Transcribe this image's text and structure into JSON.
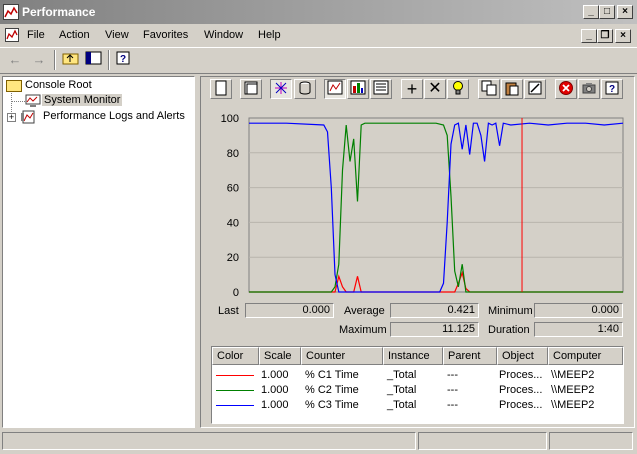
{
  "window": {
    "title": "Performance"
  },
  "menu": {
    "items": [
      "File",
      "Action",
      "View",
      "Favorites",
      "Window",
      "Help"
    ]
  },
  "tree": {
    "root": "Console Root",
    "children": [
      "System Monitor",
      "Performance Logs and Alerts"
    ]
  },
  "stats": {
    "last_label": "Last",
    "last": "0.000",
    "average_label": "Average",
    "average": "0.421",
    "minimum_label": "Minimum",
    "minimum": "0.000",
    "maximum_label": "Maximum",
    "maximum": "11.125",
    "duration_label": "Duration",
    "duration": "1:40"
  },
  "legend": {
    "headers": [
      "Color",
      "Scale",
      "Counter",
      "Instance",
      "Parent",
      "Object",
      "Computer"
    ],
    "rows": [
      {
        "color": "#ff0000",
        "scale": "1.000",
        "counter": "% C1 Time",
        "instance": "_Total",
        "parent": "---",
        "object": "Proces...",
        "computer": "\\\\MEEP2"
      },
      {
        "color": "#008000",
        "scale": "1.000",
        "counter": "% C2 Time",
        "instance": "_Total",
        "parent": "---",
        "object": "Proces...",
        "computer": "\\\\MEEP2"
      },
      {
        "color": "#0000ff",
        "scale": "1.000",
        "counter": "% C3 Time",
        "instance": "_Total",
        "parent": "---",
        "object": "Proces...",
        "computer": "\\\\MEEP2"
      }
    ]
  },
  "chart_data": {
    "type": "line",
    "ylim": [
      0,
      100
    ],
    "yticks": [
      "0",
      "20",
      "40",
      "60",
      "80",
      "100"
    ],
    "xlim": [
      0,
      100
    ],
    "grid": true,
    "current_time_marker_x": 73,
    "series": [
      {
        "name": "% C1 Time",
        "color": "#ff0000",
        "x": [
          0,
          23,
          24,
          25,
          26,
          27,
          28,
          29,
          30,
          31,
          32,
          55,
          56,
          57,
          58,
          59,
          100
        ],
        "y": [
          0,
          0,
          9,
          3,
          0,
          0,
          0,
          9,
          0,
          0,
          0,
          0,
          5,
          11,
          2,
          0,
          0
        ]
      },
      {
        "name": "% C2 Time",
        "color": "#008000",
        "x": [
          0,
          22,
          23,
          24,
          25,
          26,
          27,
          28,
          29,
          30,
          31,
          32,
          40,
          50,
          52,
          53,
          54,
          55,
          56,
          57,
          58,
          100
        ],
        "y": [
          0,
          0,
          3,
          16,
          70,
          96,
          75,
          88,
          52,
          96,
          97,
          97,
          97,
          97,
          96,
          90,
          55,
          12,
          3,
          16,
          0,
          0
        ]
      },
      {
        "name": "% C3 Time",
        "color": "#0000ff",
        "x": [
          0,
          10,
          20,
          21,
          22,
          23,
          24,
          25,
          26,
          50,
          51,
          52,
          53,
          54,
          55,
          56,
          57,
          58,
          59,
          60,
          61,
          62,
          63,
          64,
          65,
          66,
          67,
          68,
          70,
          75,
          80,
          85,
          90,
          95,
          100
        ],
        "y": [
          97,
          97,
          96,
          92,
          60,
          10,
          0,
          0,
          0,
          0,
          0,
          5,
          40,
          85,
          96,
          97,
          82,
          96,
          79,
          97,
          97,
          90,
          75,
          97,
          96,
          97,
          84,
          97,
          96,
          97,
          96,
          97,
          97,
          96,
          97
        ]
      }
    ]
  }
}
